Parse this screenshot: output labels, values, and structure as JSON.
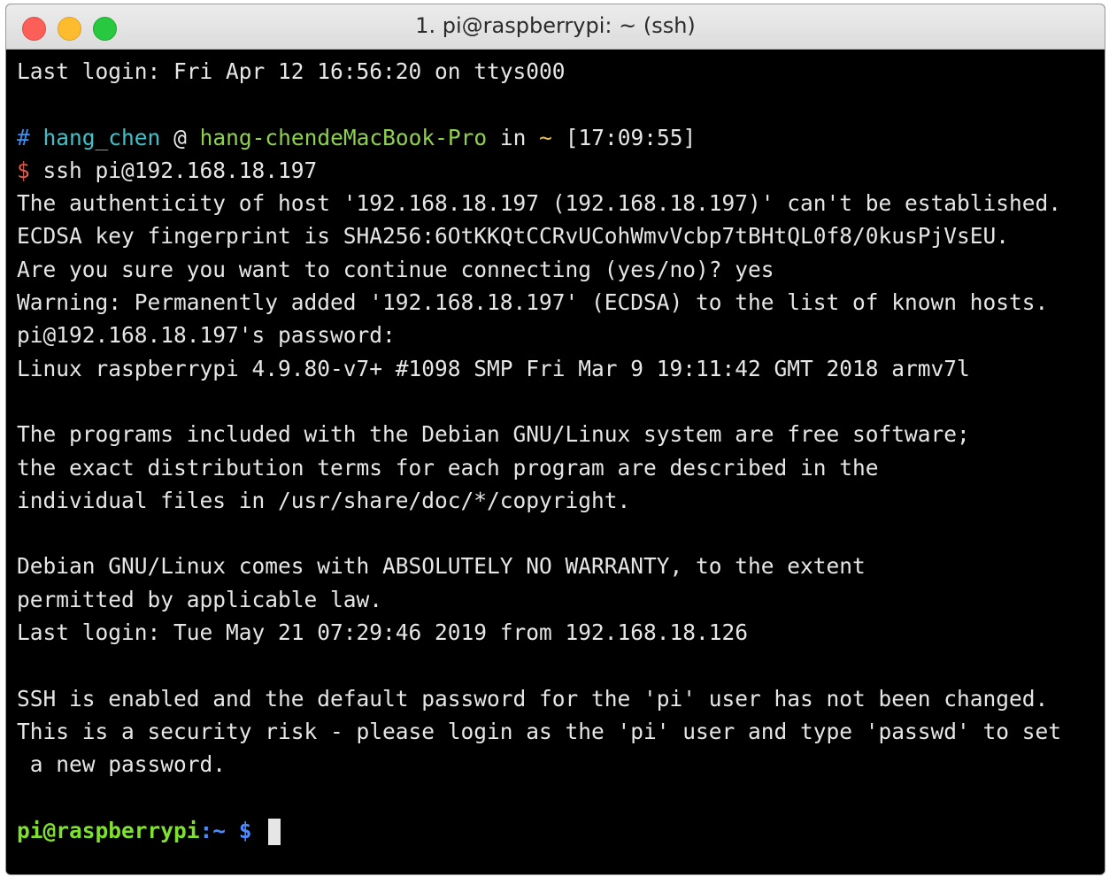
{
  "window": {
    "title": "1. pi@raspberrypi: ~ (ssh)"
  },
  "terminal": {
    "last_login_local": "Last login: Fri Apr 12 16:56:20 on ttys000",
    "zsh_prompt": {
      "hash": "#",
      "user": "hang_chen",
      "at": "@",
      "host": "hang-chendeMacBook-Pro",
      "in": "in",
      "dir": "~",
      "time": "[17:09:55]"
    },
    "command_prompt": "$",
    "command": "ssh pi@192.168.18.197",
    "output_1": [
      "The authenticity of host '192.168.18.197 (192.168.18.197)' can't be established.",
      "ECDSA key fingerprint is SHA256:6OtKKQtCCRvUCohWmvVcbp7tBHtQL0f8/0kusPjVsEU.",
      "Are you sure you want to continue connecting (yes/no)? yes",
      "Warning: Permanently added '192.168.18.197' (ECDSA) to the list of known hosts.",
      "pi@192.168.18.197's password:",
      "Linux raspberrypi 4.9.80-v7+ #1098 SMP Fri Mar 9 19:11:42 GMT 2018 armv7l"
    ],
    "output_2": [
      "The programs included with the Debian GNU/Linux system are free software;",
      "the exact distribution terms for each program are described in the",
      "individual files in /usr/share/doc/*/copyright."
    ],
    "output_3": [
      "Debian GNU/Linux comes with ABSOLUTELY NO WARRANTY, to the extent",
      "permitted by applicable law.",
      "Last login: Tue May 21 07:29:46 2019 from 192.168.18.126"
    ],
    "output_4": [
      "SSH is enabled and the default password for the 'pi' user has not been changed.",
      "This is a security risk - please login as the 'pi' user and type 'passwd' to set",
      " a new password."
    ],
    "remote_prompt": {
      "user_host": "pi@raspberrypi",
      "colon_dir": ":~",
      "symbol": "$"
    }
  },
  "colors": {
    "background": "#000000",
    "text": "#e6e6e6",
    "user": "#3fc1c9",
    "host": "#8fd14f",
    "remote_prompt": "#7fe030"
  }
}
